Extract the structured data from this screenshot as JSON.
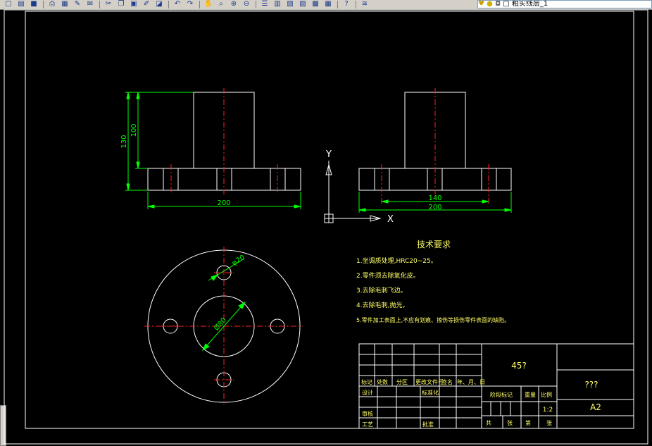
{
  "toolbar": {
    "buttons": [
      {
        "name": "new-icon",
        "glyph": "▢"
      },
      {
        "name": "open-icon",
        "glyph": "▤"
      },
      {
        "name": "save-icon",
        "glyph": "■"
      },
      {
        "name": "print-icon",
        "glyph": "⎙"
      },
      {
        "name": "plot-preview-icon",
        "glyph": "▦"
      },
      {
        "name": "publish-icon",
        "glyph": "✎"
      },
      {
        "name": "etransmit-icon",
        "glyph": "✉"
      },
      {
        "name": "cut-icon",
        "glyph": "✂"
      },
      {
        "name": "copy-icon",
        "glyph": "❐"
      },
      {
        "name": "paste-icon",
        "glyph": "▣"
      },
      {
        "name": "match-properties-icon",
        "glyph": "✐"
      },
      {
        "name": "block-editor-icon",
        "glyph": "◪"
      },
      {
        "name": "undo-icon",
        "glyph": "↶"
      },
      {
        "name": "redo-icon",
        "glyph": "↷"
      },
      {
        "name": "pan-icon",
        "glyph": "✋"
      },
      {
        "name": "zoom-realtime-icon",
        "glyph": "⌕"
      },
      {
        "name": "zoom-window-icon",
        "glyph": "⊕"
      },
      {
        "name": "zoom-previous-icon",
        "glyph": "⊖"
      },
      {
        "name": "properties-icon",
        "glyph": "☰"
      },
      {
        "name": "design-center-icon",
        "glyph": "▥"
      },
      {
        "name": "tool-palettes-icon",
        "glyph": "▧"
      },
      {
        "name": "sheet-set-icon",
        "glyph": "▨"
      },
      {
        "name": "markup-icon",
        "glyph": "▩"
      },
      {
        "name": "calculator-icon",
        "glyph": "▦"
      },
      {
        "name": "help-icon",
        "glyph": "?"
      },
      {
        "name": "layer-properties-icon",
        "glyph": "≋"
      }
    ],
    "layer_name": "粗实线层_1",
    "layer_icons": [
      "bulb-icon",
      "sun-icon",
      "lock-icon",
      "color-swatch-icon"
    ]
  },
  "drawing": {
    "front_view_dims": {
      "height_130": "130",
      "height_100": "100",
      "width_200": "200"
    },
    "side_view_dims": {
      "width_140": "140",
      "width_200": "200"
    },
    "ucs": {
      "y_label": "Y",
      "x_label": "X"
    },
    "plan_view_dims": {
      "hole_dia": "φ20",
      "center_dia": "Ø80"
    },
    "tech_req": {
      "title": "技术要求",
      "items": [
        "1.坐调质处理,HRC20~25。",
        "2.零件须去除氧化皮。",
        "3.去除毛刺飞边。",
        "4.去除毛刺,抛光。",
        "5.零件加工表面上,不应有划痕、擦伤等损伤零件表面的缺陷。"
      ]
    },
    "title_block": {
      "material": "45?",
      "part_name": "???",
      "drawing_no": "A2",
      "scale_value": "1:2",
      "labels": {
        "mark": "标记",
        "count": "处数",
        "zone": "分区",
        "change_doc": "更改文件号",
        "sign": "签名",
        "date": "年、月、日",
        "design": "设计",
        "standardize": "标准化",
        "stage_mark": "阶段标记",
        "weight": "重量",
        "scale": "比例",
        "review": "审核",
        "process": "工艺",
        "approve": "批准",
        "total": "共",
        "sheets": "张",
        "no": "第",
        "sheet": "张"
      }
    }
  },
  "colors": {
    "background": "#000000",
    "geometry": "#ffffff",
    "center": "#ff2020",
    "dimension": "#00ff00",
    "text": "#ffff66",
    "toolbar": "#d4d0c8"
  }
}
